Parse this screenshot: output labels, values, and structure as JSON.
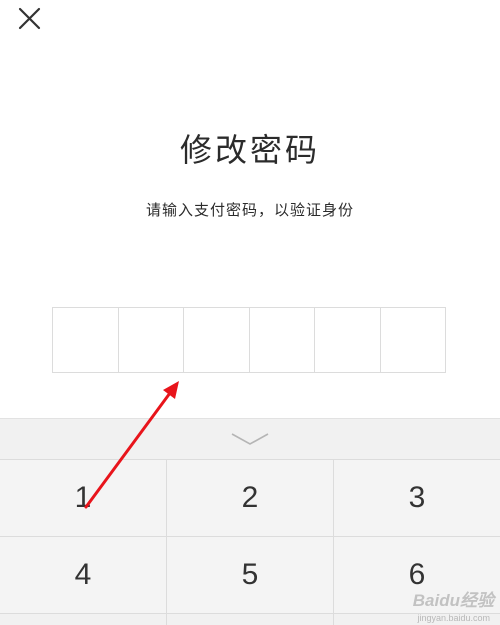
{
  "header": {
    "close_icon": "close-icon"
  },
  "main": {
    "title": "修改密码",
    "subtitle": "请输入支付密码，以验证身份",
    "pin_length": 6
  },
  "keyboard": {
    "collapse_icon": "chevron-down-icon",
    "keys": [
      "1",
      "2",
      "3",
      "4",
      "5",
      "6"
    ]
  },
  "watermark": {
    "text": "Baidu经验",
    "sub": "jingyan.baidu.com"
  },
  "colors": {
    "annotation_arrow": "#e8141b"
  }
}
